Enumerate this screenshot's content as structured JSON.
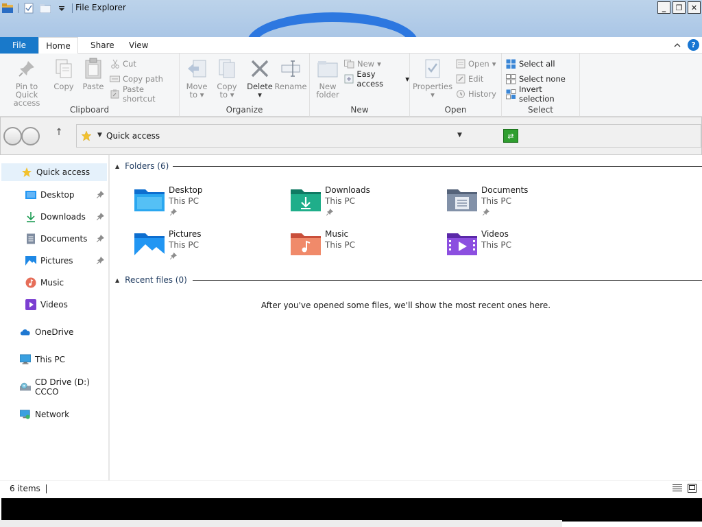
{
  "window": {
    "title": "File Explorer",
    "controls": {
      "minimize": "_",
      "restore": "❐",
      "close": "✕"
    }
  },
  "ribbon": {
    "tabs": {
      "file": "File",
      "home": "Home",
      "share": "Share",
      "view": "View"
    },
    "help": "?",
    "clipboard": {
      "label": "Clipboard",
      "pin_line1": "Pin to Quick",
      "pin_line2": "access",
      "copy": "Copy",
      "paste": "Paste",
      "cut": "Cut",
      "copy_path": "Copy path",
      "paste_shortcut": "Paste shortcut"
    },
    "organize": {
      "label": "Organize",
      "move_line1": "Move",
      "move_line2": "to",
      "copy_line1": "Copy",
      "copy_line2": "to",
      "delete": "Delete",
      "rename": "Rename"
    },
    "new": {
      "label": "New",
      "new_folder_line1": "New",
      "new_folder_line2": "folder",
      "new_item": "New",
      "easy_access": "Easy access"
    },
    "open": {
      "label": "Open",
      "properties": "Properties",
      "open": "Open",
      "edit": "Edit",
      "history": "History"
    },
    "select": {
      "label": "Select",
      "select_all": "Select all",
      "select_none": "Select none",
      "invert": "Invert selection"
    }
  },
  "address": {
    "location": "Quick access",
    "up": "↑"
  },
  "sidebar": {
    "items": [
      {
        "label": "Quick access",
        "icon": "star-icon"
      },
      {
        "label": "Desktop",
        "icon": "desktop-icon",
        "pinned": true
      },
      {
        "label": "Downloads",
        "icon": "download-icon",
        "pinned": true
      },
      {
        "label": "Documents",
        "icon": "documents-icon",
        "pinned": true
      },
      {
        "label": "Pictures",
        "icon": "pictures-icon",
        "pinned": true
      },
      {
        "label": "Music",
        "icon": "music-icon"
      },
      {
        "label": "Videos",
        "icon": "videos-icon"
      },
      {
        "label": "OneDrive",
        "icon": "cloud-icon"
      },
      {
        "label": "This PC",
        "icon": "monitor-icon"
      },
      {
        "label": "CD Drive (D:) CCCO",
        "icon": "cd-drive-icon"
      },
      {
        "label": "Network",
        "icon": "network-icon"
      }
    ]
  },
  "content": {
    "folders_header": "Folders (6)",
    "recent_header": "Recent files (0)",
    "empty_message": "After you've opened some files, we'll show the most recent ones here.",
    "folders": [
      {
        "name": "Desktop",
        "location": "This PC",
        "pinned": true,
        "color": "#1e88e5"
      },
      {
        "name": "Downloads",
        "location": "This PC",
        "pinned": true,
        "color": "#16a085"
      },
      {
        "name": "Documents",
        "location": "This PC",
        "pinned": true,
        "color": "#6d7b91"
      },
      {
        "name": "Pictures",
        "location": "This PC",
        "pinned": true,
        "color": "#1e88e5"
      },
      {
        "name": "Music",
        "location": "This PC",
        "pinned": false,
        "color": "#e6705a"
      },
      {
        "name": "Videos",
        "location": "This PC",
        "pinned": false,
        "color": "#7b3fd1"
      }
    ]
  },
  "status": {
    "item_count": "6 items"
  },
  "colors": {
    "accent": "#1979ca",
    "selected_bg": "#e5f1fb"
  }
}
